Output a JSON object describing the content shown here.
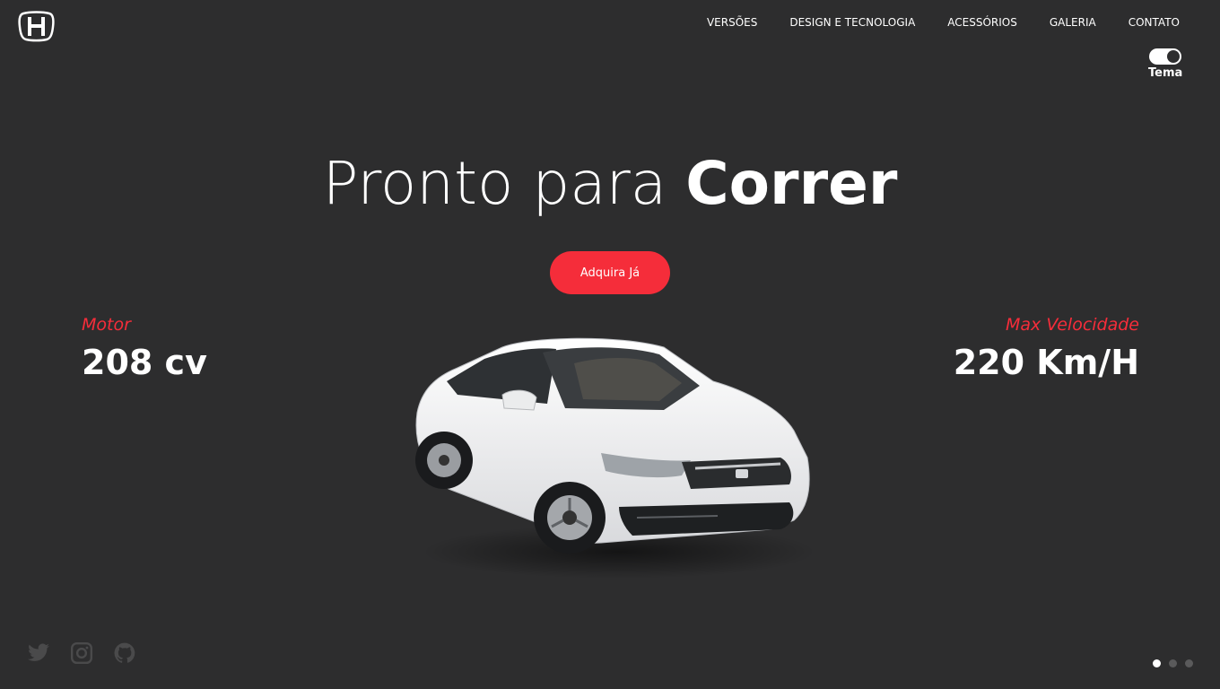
{
  "header": {
    "logo_icon": "honda-logo-icon",
    "nav": [
      {
        "label": "VERSÕES"
      },
      {
        "label": "DESIGN E TECNOLOGIA"
      },
      {
        "label": "ACESSÓRIOS"
      },
      {
        "label": "GALERIA"
      },
      {
        "label": "CONTATO"
      }
    ],
    "theme": {
      "label": "Tema",
      "toggle_on": true
    }
  },
  "hero": {
    "title_light": "Pronto para ",
    "title_bold": "Correr",
    "cta_label": "Adquira Já",
    "car_image": "white-sedan-car"
  },
  "stats": {
    "left": {
      "label": "Motor",
      "value": "208 cv"
    },
    "right": {
      "label": "Max Velocidade",
      "value": "220 Km/H"
    }
  },
  "social": {
    "icons": [
      "twitter-icon",
      "instagram-icon",
      "github-icon"
    ]
  },
  "carousel": {
    "slides": 3,
    "active": 1
  },
  "colors": {
    "background": "#2d2d2e",
    "accent": "#f52d3a",
    "text": "#ffffff",
    "muted": "#5a5a5b"
  }
}
